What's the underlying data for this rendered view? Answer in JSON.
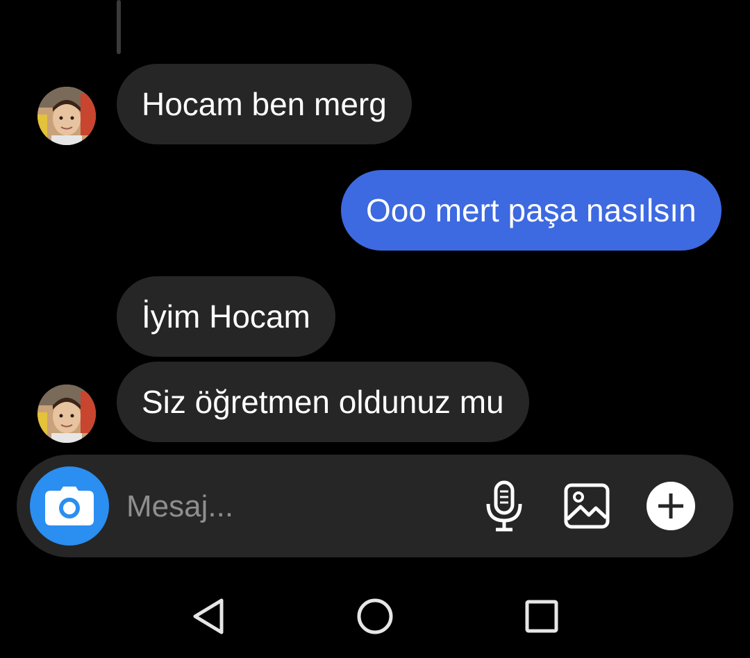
{
  "thread": {
    "messages": [
      {
        "direction": "incoming",
        "text": "Hocam ben merg",
        "has_avatar": true
      },
      {
        "direction": "outgoing",
        "text": "Ooo mert paşa nasılsın",
        "has_avatar": false
      },
      {
        "direction": "incoming",
        "text": "İyim Hocam",
        "has_avatar": false
      },
      {
        "direction": "incoming",
        "text": "Siz öğretmen oldunuz mu",
        "has_avatar": true
      }
    ]
  },
  "composer": {
    "placeholder": "Mesaj...",
    "value": "",
    "icons": {
      "camera": "camera-icon",
      "microphone": "microphone-icon",
      "gallery": "gallery-icon",
      "add": "plus-icon"
    }
  },
  "nav_bar": {
    "icons": [
      "back-icon",
      "home-icon",
      "recents-icon"
    ]
  },
  "colors": {
    "background": "#000000",
    "incoming_bubble": "#262626",
    "outgoing_bubble": "#3d69e1",
    "camera_button": "#2b8ef1",
    "placeholder_text": "#8e8e8e"
  }
}
